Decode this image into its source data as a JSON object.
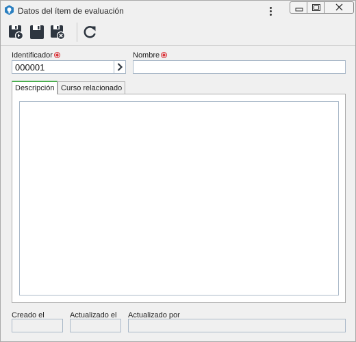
{
  "window": {
    "title": "Datos del ítem de evaluación",
    "accent": "#2a7fc0"
  },
  "toolbar": {
    "items": [
      {
        "name": "save-and-new-icon"
      },
      {
        "name": "save-icon"
      },
      {
        "name": "save-and-close-icon"
      },
      {
        "name": "refresh-icon"
      }
    ]
  },
  "form": {
    "identificador_label": "Identificador",
    "identificador_value": "000001",
    "nombre_label": "Nombre",
    "nombre_value": "",
    "required_color": "#d9262c"
  },
  "tabs": [
    {
      "label": "Descripción",
      "active": true
    },
    {
      "label": "Curso relacionado",
      "active": false
    }
  ],
  "description": {
    "value": ""
  },
  "footer": {
    "creado_label": "Creado el",
    "creado_value": "",
    "actualizado_label": "Actualizado el",
    "actualizado_value": "",
    "actualizado_por_label": "Actualizado por",
    "actualizado_por_value": ""
  }
}
